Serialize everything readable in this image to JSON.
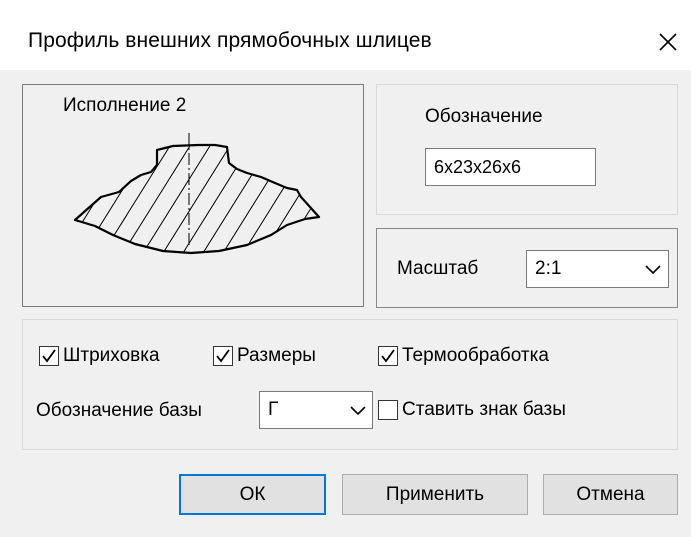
{
  "dialog": {
    "title": "Профиль внешних прямобочных шлицев",
    "close_glyph": "✕"
  },
  "preview": {
    "label": "Исполнение 2",
    "image": "spline-profile-section-drawing"
  },
  "designation": {
    "label": "Обозначение",
    "value": "6x23x26x6"
  },
  "scale": {
    "label": "Масштаб",
    "selected": "2:1"
  },
  "options": {
    "hatching": {
      "label": "Штриховка",
      "checked": true
    },
    "dimensions": {
      "label": "Размеры",
      "checked": true
    },
    "heat_treatment": {
      "label": "Термообработка",
      "checked": true
    },
    "base_designation_label": "Обозначение базы",
    "base_designation_value": "Г",
    "set_base_mark": {
      "label": "Ставить знак базы",
      "checked": false
    }
  },
  "buttons": {
    "ok": "ОК",
    "apply": "Применить",
    "cancel": "Отмена"
  },
  "colors": {
    "dialog_bg": "#f0f0f0",
    "titlebar_bg": "#ffffff",
    "accent": "#0078d7"
  }
}
